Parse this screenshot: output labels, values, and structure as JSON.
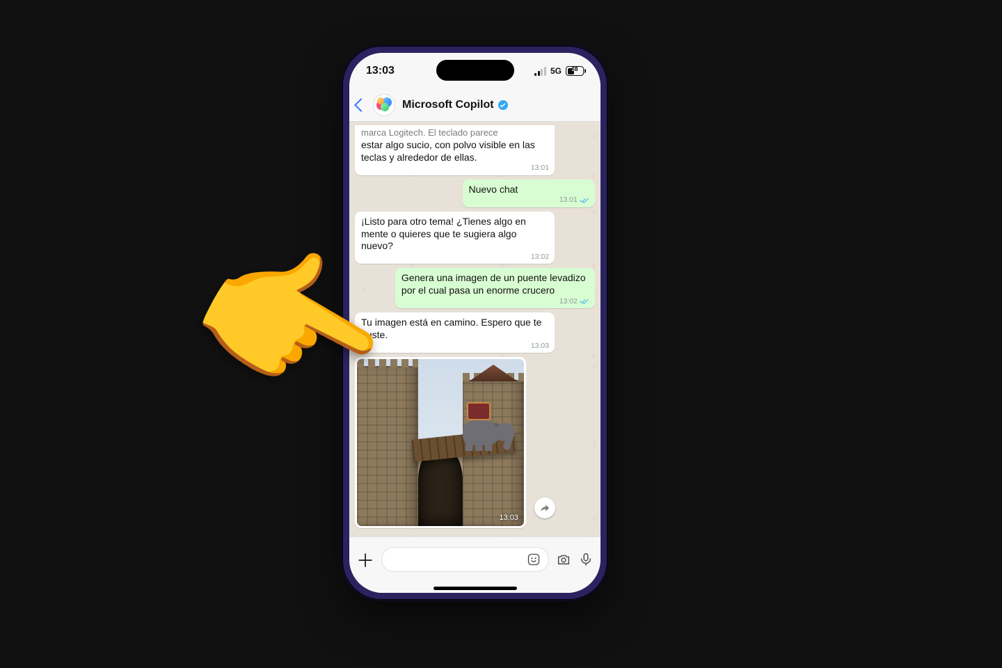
{
  "status": {
    "time": "13:03",
    "network": "5G",
    "battery_pct": "38"
  },
  "header": {
    "title": "Microsoft Copilot"
  },
  "messages": {
    "m0_prev_cut": "marca Logitech. El teclado parece",
    "m0_body": "estar algo sucio, con polvo visible en las teclas y alrededor de ellas.",
    "m0_ts": "13:01",
    "m1_body": "Nuevo chat",
    "m1_ts": "13:01",
    "m2_body": "¡Listo para otro tema! ¿Tienes algo en mente o quieres que te sugiera algo nuevo?",
    "m2_ts": "13:02",
    "m3_body": "Genera una imagen de un puente levadizo por el cual pasa un enorme crucero",
    "m3_ts": "13:02",
    "m4_body": "Tu imagen está en camino. Espero que te guste.",
    "m4_ts": "13:03",
    "img_ts": "13:03"
  }
}
